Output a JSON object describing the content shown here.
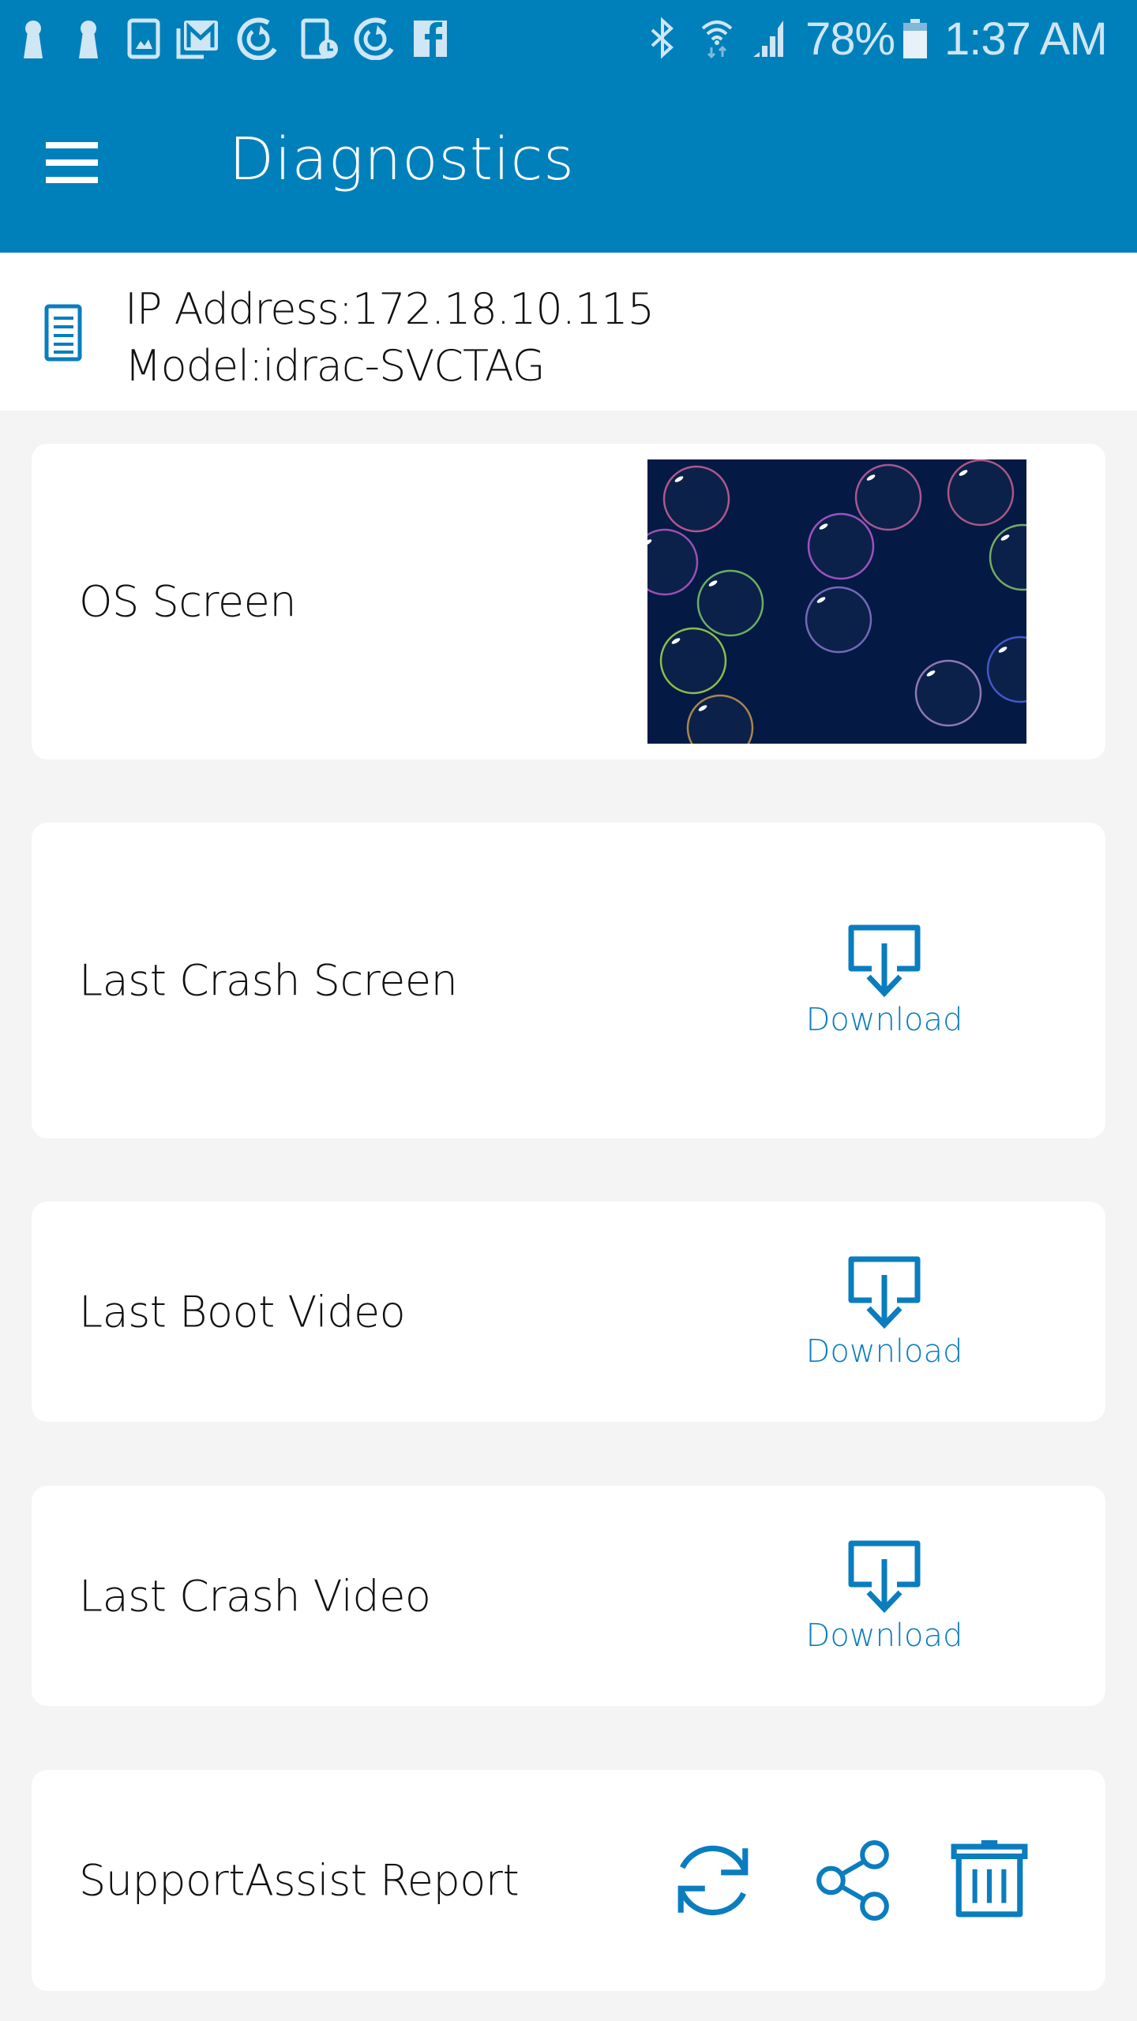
{
  "status_bar": {
    "notification_icons": [
      "keyhole-icon",
      "keyhole-icon",
      "gallery-icon",
      "gmail-stack-icon",
      "sync-circle-icon",
      "tablet-clock-icon",
      "sync-circle-icon",
      "facebook-icon"
    ],
    "system_icons": [
      "bluetooth-icon",
      "wifi-icon",
      "signal-icon"
    ],
    "battery_percent": "78%",
    "battery_level": 0.78,
    "time": "1:37 AM"
  },
  "app_bar": {
    "title": "Diagnostics",
    "menu_icon": "hamburger-menu-icon"
  },
  "device": {
    "icon": "document-list-icon",
    "ip_line": "IP Address:172.18.10.115",
    "model_line": "Model:idrac-SVCTAG"
  },
  "cards": [
    {
      "label": "OS Screen",
      "type": "thumbnail",
      "thumbnail": "desktop-bubbles-screenshot"
    },
    {
      "label": "Last Crash Screen",
      "type": "download",
      "action_label": "Download"
    },
    {
      "label": "Last Boot Video",
      "type": "download",
      "action_label": "Download"
    },
    {
      "label": "Last Crash Video",
      "type": "download",
      "action_label": "Download"
    },
    {
      "label": "SupportAssist Report",
      "type": "actions",
      "actions": [
        "refresh-icon",
        "share-icon",
        "trash-icon"
      ]
    }
  ],
  "colors": {
    "brand_blue": "#0080bb",
    "icon_blue": "#0a7dbf",
    "page_bg": "#f4f4f4",
    "card_bg": "#ffffff",
    "thumb_bg": "#041a44"
  }
}
